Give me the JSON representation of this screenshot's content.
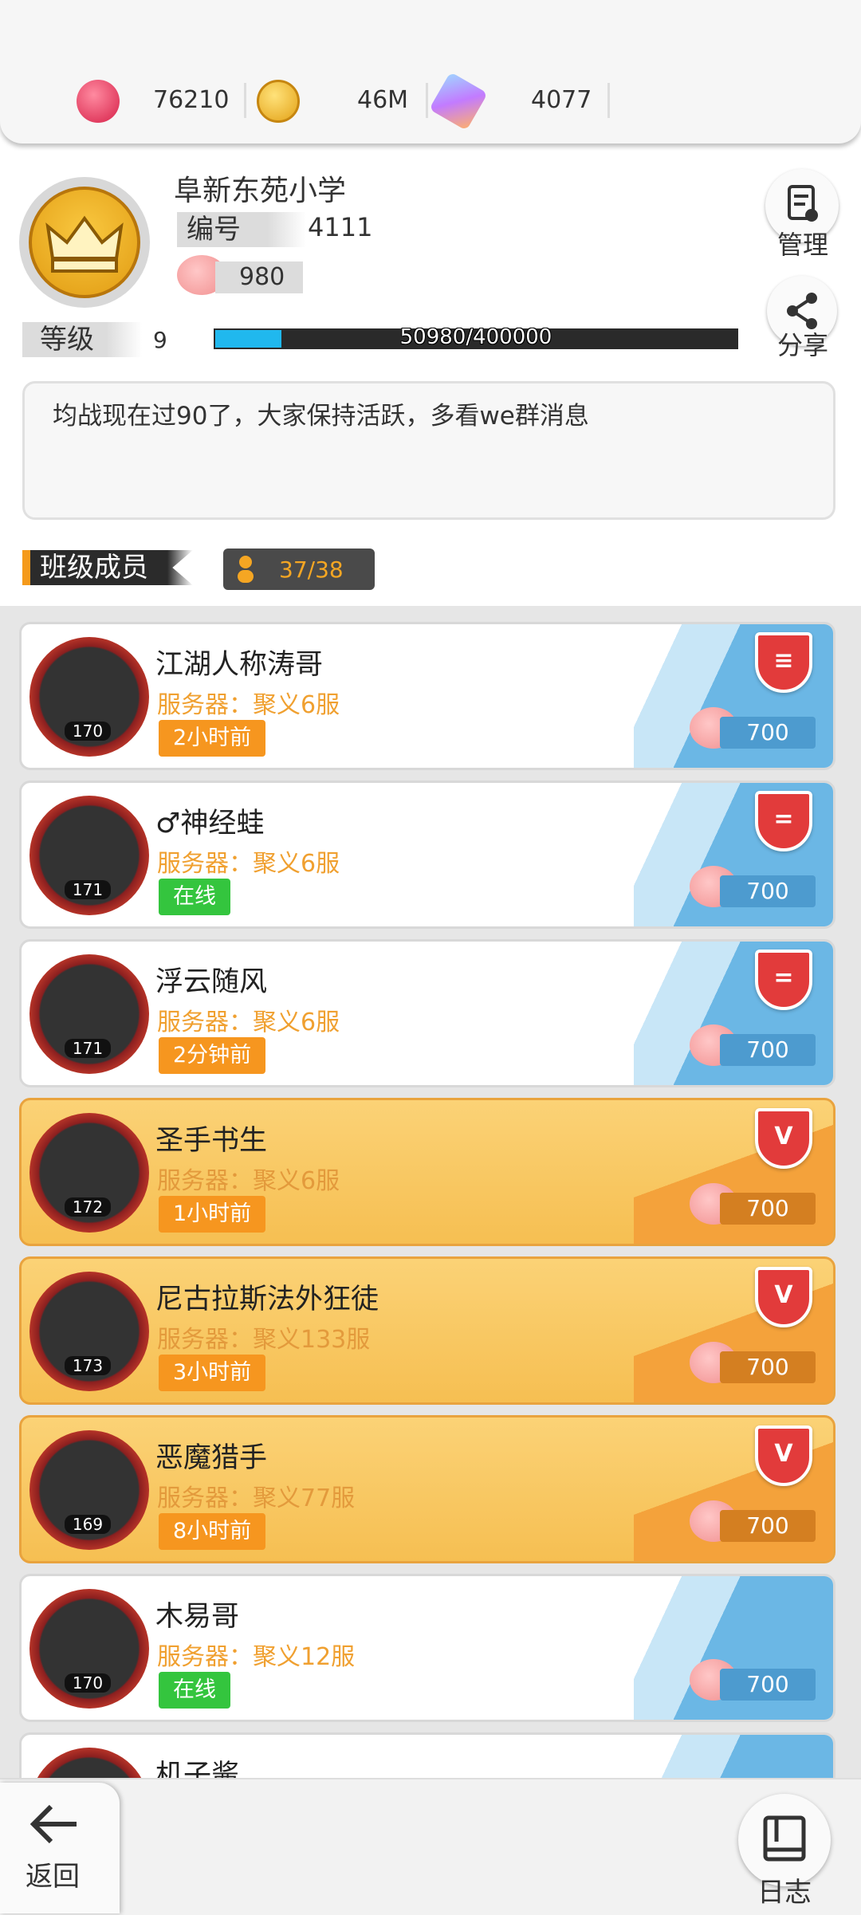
{
  "currency": {
    "ruby": "76210",
    "coin": "46M",
    "gem": "4077"
  },
  "profile": {
    "school": "阜新东苑小学",
    "id_label": "编号",
    "id_value": "4111",
    "pig_value": "980",
    "level_label": "等级",
    "level_value": "9",
    "exp_text": "50980/400000",
    "exp_progress": 0.1275
  },
  "side": {
    "manage_label": "管理",
    "share_label": "分享"
  },
  "notice": "均战现在过90了，大家保持活跃，多看we群消息",
  "section": {
    "title": "班级成员",
    "count": "37/38"
  },
  "members": [
    {
      "name": "江湖人称涛哥",
      "server": "服务器：聚义6服",
      "status": "2小时前",
      "status_type": "orange",
      "level": "170",
      "score": "700",
      "style": "white",
      "badge": "≡"
    },
    {
      "name": "♂神经蛙",
      "server": "服务器：聚义6服",
      "status": "在线",
      "status_type": "green",
      "level": "171",
      "score": "700",
      "style": "white",
      "badge": "="
    },
    {
      "name": "浮云随风",
      "server": "服务器：聚义6服",
      "status": "2分钟前",
      "status_type": "orange",
      "level": "171",
      "score": "700",
      "style": "white",
      "badge": "="
    },
    {
      "name": "圣手书生",
      "server": "服务器：聚义6服",
      "status": "1小时前",
      "status_type": "orange",
      "level": "172",
      "score": "700",
      "style": "gold",
      "badge": "V"
    },
    {
      "name": "尼古拉斯法外狂徒",
      "server": "服务器：聚义133服",
      "status": "3小时前",
      "status_type": "orange",
      "level": "173",
      "score": "700",
      "style": "gold",
      "badge": "V"
    },
    {
      "name": "恶魔猎手",
      "server": "服务器：聚义77服",
      "status": "8小时前",
      "status_type": "orange",
      "level": "169",
      "score": "700",
      "style": "gold",
      "badge": "V"
    },
    {
      "name": "木易哥",
      "server": "服务器：聚义12服",
      "status": "在线",
      "status_type": "green",
      "level": "170",
      "score": "700",
      "style": "white",
      "badge": ""
    },
    {
      "name": "机子酱",
      "server": "",
      "status": "",
      "status_type": "",
      "level": "",
      "score": "",
      "style": "white",
      "badge": ""
    }
  ],
  "bottom": {
    "back_label": "返回",
    "log_label": "日志"
  }
}
